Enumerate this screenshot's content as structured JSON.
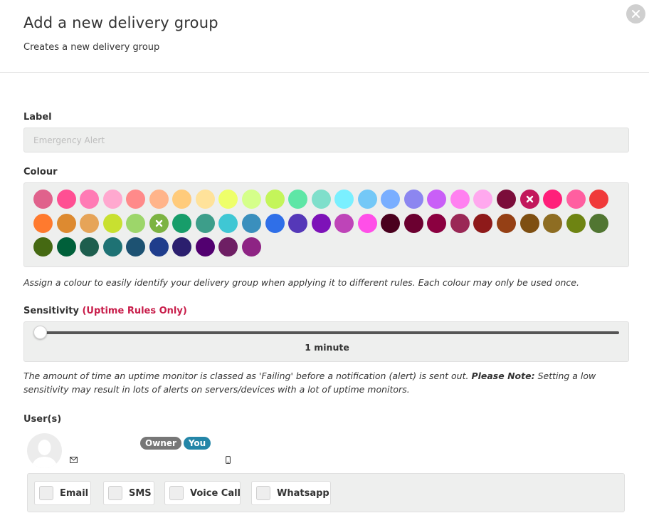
{
  "header": {
    "title": "Add a new delivery group",
    "subtitle": "Creates a new delivery group",
    "close_icon": "close-icon"
  },
  "label_field": {
    "label": "Label",
    "value": "",
    "placeholder": "Emergency Alert"
  },
  "colour": {
    "label": "Colour",
    "selected": [
      "#C2185B",
      "#7CB342"
    ],
    "swatches": [
      "#E0628C",
      "#FF4F93",
      "#FF7BB5",
      "#FFA8CF",
      "#FF8A8A",
      "#FFB48A",
      "#FFCB7B",
      "#FFE29A",
      "#EEFF6A",
      "#D5FF8A",
      "#C4F55A",
      "#5EE6A6",
      "#7FDFCB",
      "#7AF0FF",
      "#74C8F7",
      "#79AEFF",
      "#8C86F0",
      "#C95FF7",
      "#FF80F0",
      "#FFA8EE",
      "#7B0D3A",
      "#C2185B",
      "#FF1F7A",
      "#FF5FA0",
      "#F03A3A",
      "#FF7A2E",
      "#DD8A30",
      "#E6A458",
      "#C8E030",
      "#9DD66A",
      "#7CB342",
      "#179D6A",
      "#3D9E8A",
      "#3FC7D4",
      "#3A8FBD",
      "#2F6FE8",
      "#5538B8",
      "#7D12B8",
      "#BE44B8",
      "#FF4FE8",
      "#4A001E",
      "#6B0030",
      "#8B0040",
      "#9A2856",
      "#8E1A1A",
      "#954015",
      "#7E4F12",
      "#8E6D22",
      "#6E8412",
      "#517632",
      "#456912",
      "#00603A",
      "#1E5E4E",
      "#1E7274",
      "#1D5272",
      "#1F3D8C",
      "#2B1F6E",
      "#520070",
      "#6E1F64",
      "#8E2484"
    ]
  },
  "colour_help": "Assign a colour to easily identify your delivery group when applying it to different rules. Each colour may only be used once.",
  "sensitivity": {
    "label": "Sensitivity",
    "label_accent": "(Uptime Rules Only)",
    "value_text": "1 minute",
    "value_fraction": 0
  },
  "sensitivity_help": {
    "text": "The amount of time an uptime monitor is classed as 'Failing' before a notification (alert) is sent out.",
    "note_label": "Please Note:",
    "note_text": "Setting a low sensitivity may result in lots of alerts on servers/devices with a lot of uptime monitors."
  },
  "users": {
    "label": "User(s)",
    "user": {
      "avatar_icon": "avatar-placeholder-icon",
      "email_icon": "envelope-icon",
      "phone_icon": "mobile-phone-icon",
      "badges": [
        "Owner",
        "You"
      ]
    }
  },
  "channels": [
    {
      "label": "Email",
      "checked": false
    },
    {
      "label": "SMS",
      "checked": false
    },
    {
      "label": "Voice Call",
      "checked": false
    },
    {
      "label": "Whatsapp",
      "checked": false
    }
  ]
}
